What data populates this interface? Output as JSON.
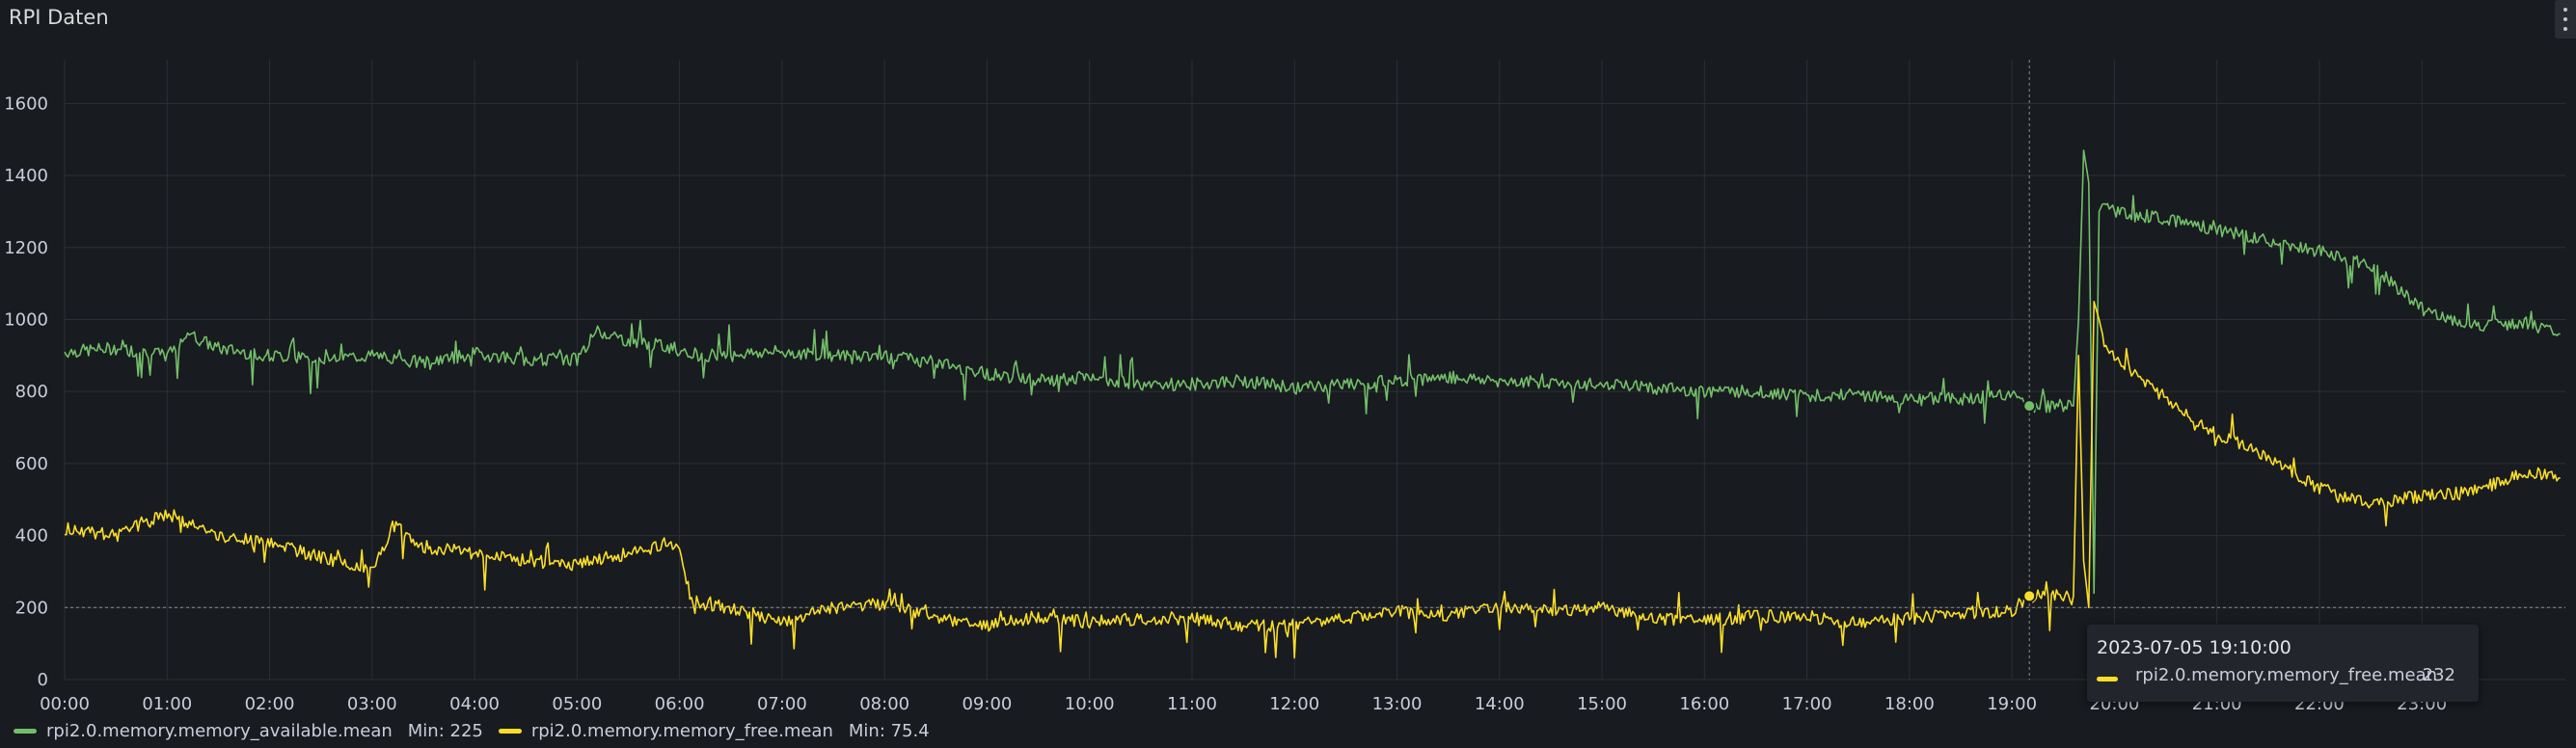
{
  "panel": {
    "title": "RPI Daten"
  },
  "chart_data": {
    "type": "line",
    "ylim": [
      0,
      1700
    ],
    "yticks": [
      "0",
      "200",
      "400",
      "600",
      "800",
      "1000",
      "1200",
      "1400",
      "1600"
    ],
    "ytick_values": [
      0,
      200,
      400,
      600,
      800,
      1000,
      1200,
      1400,
      1600
    ],
    "xticks": [
      "00:00",
      "01:00",
      "02:00",
      "03:00",
      "04:00",
      "05:00",
      "06:00",
      "07:00",
      "08:00",
      "09:00",
      "10:00",
      "11:00",
      "12:00",
      "13:00",
      "14:00",
      "15:00",
      "16:00",
      "17:00",
      "18:00",
      "19:00",
      "20:00",
      "21:00",
      "22:00",
      "23:00"
    ],
    "xlim_hours": [
      0,
      24.4
    ],
    "grid": true,
    "legend_position": "bottom-left",
    "series": [
      {
        "name": "rpi2.0.memory.memory_available.mean",
        "color": "#73bf69",
        "legend_stat": "Min: 225",
        "x": [
          0,
          0.5,
          1,
          1.2,
          1.5,
          2,
          2.5,
          3,
          3.5,
          4,
          4.5,
          5,
          5.2,
          5.5,
          6,
          6.2,
          6.5,
          7,
          7.5,
          8,
          8.5,
          9,
          9.5,
          10,
          10.5,
          11,
          11.5,
          12,
          12.5,
          13,
          13.5,
          14,
          14.5,
          15,
          15.5,
          16,
          16.5,
          17,
          17.5,
          18,
          18.5,
          19,
          19.17,
          19.6,
          19.65,
          19.7,
          19.75,
          19.8,
          19.85,
          19.9,
          20,
          20.5,
          21,
          21.5,
          22,
          22.5,
          23,
          23.5,
          24,
          24.35
        ],
        "y": [
          910,
          920,
          900,
          960,
          920,
          900,
          890,
          900,
          880,
          905,
          890,
          890,
          970,
          940,
          920,
          900,
          905,
          910,
          900,
          900,
          880,
          850,
          830,
          840,
          820,
          820,
          830,
          810,
          820,
          830,
          840,
          830,
          825,
          820,
          810,
          800,
          800,
          790,
          790,
          780,
          780,
          790,
          760,
          760,
          1000,
          1470,
          1380,
          240,
          1300,
          1330,
          1300,
          1280,
          1250,
          1220,
          1190,
          1150,
          1030,
          980,
          990,
          960
        ]
      },
      {
        "name": "rpi2.0.memory.memory_free.mean",
        "color": "#fade2a",
        "legend_stat": "Min: 75.4",
        "x": [
          0,
          0.5,
          1,
          1.2,
          1.5,
          2,
          2.5,
          3,
          3.2,
          3.5,
          4,
          4.5,
          5,
          5.5,
          6,
          6.1,
          6.2,
          6.5,
          7,
          7.5,
          8,
          8.5,
          9,
          9.5,
          10,
          10.5,
          11,
          11.5,
          12,
          12.5,
          13,
          13.5,
          14,
          14.5,
          15,
          15.5,
          16,
          16.5,
          17,
          17.5,
          18,
          18.5,
          19,
          19.17,
          19.6,
          19.65,
          19.7,
          19.75,
          19.8,
          19.85,
          19.9,
          20,
          20.5,
          21,
          21.5,
          22,
          22.5,
          23,
          23.5,
          24,
          24.35
        ],
        "y": [
          420,
          400,
          460,
          440,
          400,
          380,
          340,
          300,
          430,
          370,
          350,
          330,
          320,
          350,
          380,
          230,
          210,
          200,
          160,
          200,
          210,
          170,
          150,
          175,
          160,
          170,
          170,
          150,
          150,
          170,
          190,
          180,
          200,
          190,
          200,
          170,
          165,
          175,
          175,
          155,
          170,
          185,
          190,
          232,
          232,
          900,
          330,
          200,
          1050,
          1000,
          940,
          900,
          780,
          680,
          620,
          530,
          490,
          510,
          520,
          580,
          560
        ]
      }
    ],
    "hover": {
      "time": "2023-07-05 19:10:00",
      "series": "rpi2.0.memory.memory_free.mean",
      "value": "232",
      "x_hours": 19.17,
      "y_value": 200
    }
  }
}
